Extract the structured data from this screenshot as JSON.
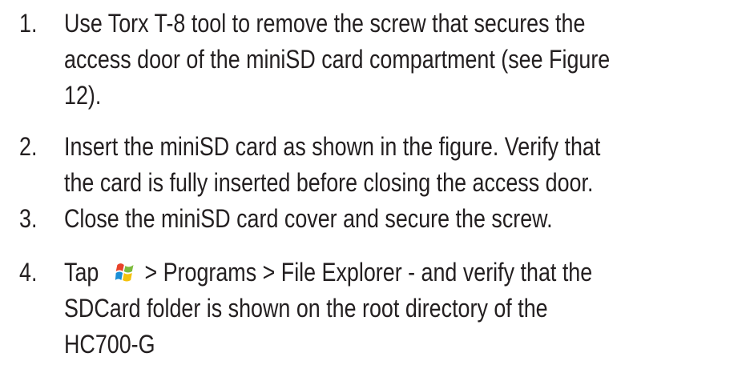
{
  "steps": [
    {
      "number": "1.",
      "lines": [
        "Use Torx T-8 tool to remove the screw that secures the",
        "access door of the miniSD card compartment (see Figure",
        "12)."
      ]
    },
    {
      "number": "2.",
      "lines": [
        "Insert the miniSD card as shown in the figure. Verify that",
        "the card is fully inserted before closing the access door."
      ]
    },
    {
      "number": "3.",
      "lines": [
        "Close the miniSD card cover and secure the screw."
      ]
    },
    {
      "number": "4.",
      "lead": "Tap",
      "icon": "windows-start-icon",
      "rest_first": "> Programs > File Explorer - and verify that the",
      "lines_more": [
        "SDCard folder is shown on the root directory of the",
        "HC700-G"
      ]
    }
  ]
}
